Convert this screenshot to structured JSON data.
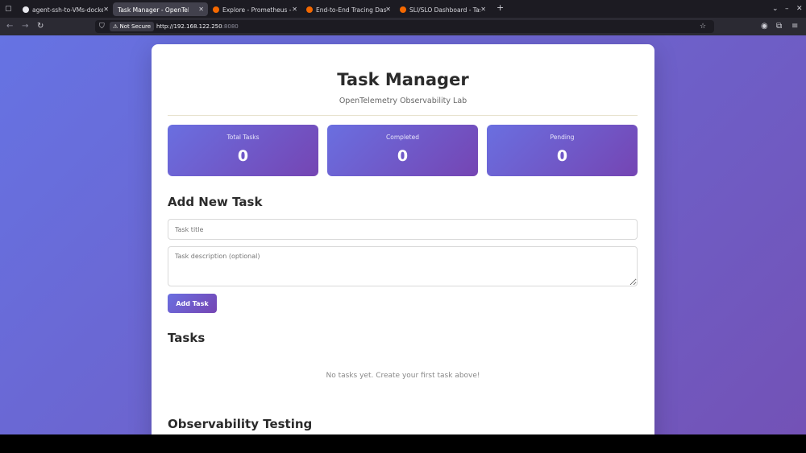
{
  "browser": {
    "tabs": [
      {
        "title": "agent-ssh-to-VMs-docker",
        "active": false,
        "favicon_color": "#e8e8ee"
      },
      {
        "title": "Task Manager - OpenTelemetr",
        "active": true,
        "favicon_color": "#ffffff"
      },
      {
        "title": "Explore - Prometheus - Gr",
        "active": false,
        "favicon_color": "#f46800"
      },
      {
        "title": "End-to-End Tracing Dashb",
        "active": false,
        "favicon_color": "#f46800"
      },
      {
        "title": "SLI/SLO Dashboard - Task",
        "active": false,
        "favicon_color": "#f46800"
      }
    ],
    "new_tab_label": "+",
    "close_label": "✕",
    "not_secure_label": "Not Secure",
    "url_host": "http://192.168.122.250",
    "url_port": ":8080"
  },
  "colors": {
    "background_gradient": [
      "#6673e3",
      "#7352b6"
    ],
    "accent_gradient": [
      "#6a6fe0",
      "#7545b3"
    ]
  },
  "page": {
    "title": "Task Manager",
    "subtitle": "OpenTelemetry Observability Lab",
    "stats": [
      {
        "label": "Total Tasks",
        "value": "0"
      },
      {
        "label": "Completed",
        "value": "0"
      },
      {
        "label": "Pending",
        "value": "0"
      }
    ],
    "add_task": {
      "heading": "Add New Task",
      "title_placeholder": "Task title",
      "description_placeholder": "Task description (optional)",
      "button_label": "Add Task"
    },
    "tasks": {
      "heading": "Tasks",
      "empty_message": "No tasks yet. Create your first task above!"
    },
    "observability": {
      "heading": "Observability Testing"
    }
  }
}
